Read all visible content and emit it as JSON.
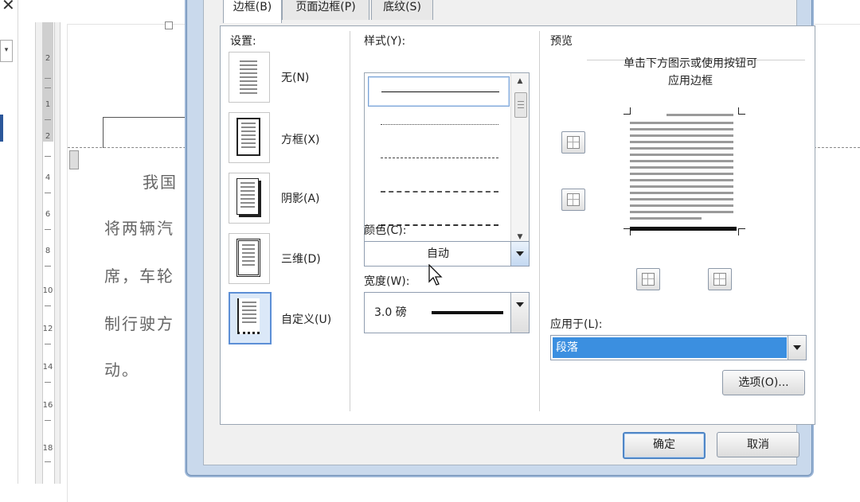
{
  "tabs": [
    {
      "label": "边框(B)",
      "active": true
    },
    {
      "label": "页面边框(P)",
      "active": false
    },
    {
      "label": "底纹(S)",
      "active": false
    }
  ],
  "settings": {
    "label": "设置:",
    "items": [
      {
        "label": "无(N)"
      },
      {
        "label": "方框(X)"
      },
      {
        "label": "阴影(A)"
      },
      {
        "label": "三维(D)"
      },
      {
        "label": "自定义(U)",
        "selected": true
      }
    ]
  },
  "style": {
    "label": "样式(Y):",
    "items": [
      "solid",
      "dotted",
      "dashed-small",
      "dashed",
      "dash-dot"
    ],
    "selected_index": 0
  },
  "color": {
    "label": "颜色(C):",
    "value": "自动"
  },
  "width": {
    "label": "宽度(W):",
    "value": "3.0 磅"
  },
  "preview": {
    "label": "预览",
    "hint_line1": "单击下方图示或使用按钮可",
    "hint_line2": "应用边框"
  },
  "apply_to": {
    "label": "应用于(L):",
    "value": "段落"
  },
  "buttons": {
    "options": "选项(O)...",
    "ok": "确定",
    "cancel": "取消"
  },
  "document": {
    "lines": [
      "我国",
      "将两辆汽",
      "席，车轮",
      "制行驶方",
      "动。"
    ],
    "ruler_numbers": [
      "2",
      "1",
      "2",
      "4",
      "6",
      "8",
      "10",
      "12",
      "14",
      "16",
      "18"
    ]
  },
  "colors": {
    "selection_blue": "#3b8fe0",
    "accent_border": "#5c8fd6"
  }
}
